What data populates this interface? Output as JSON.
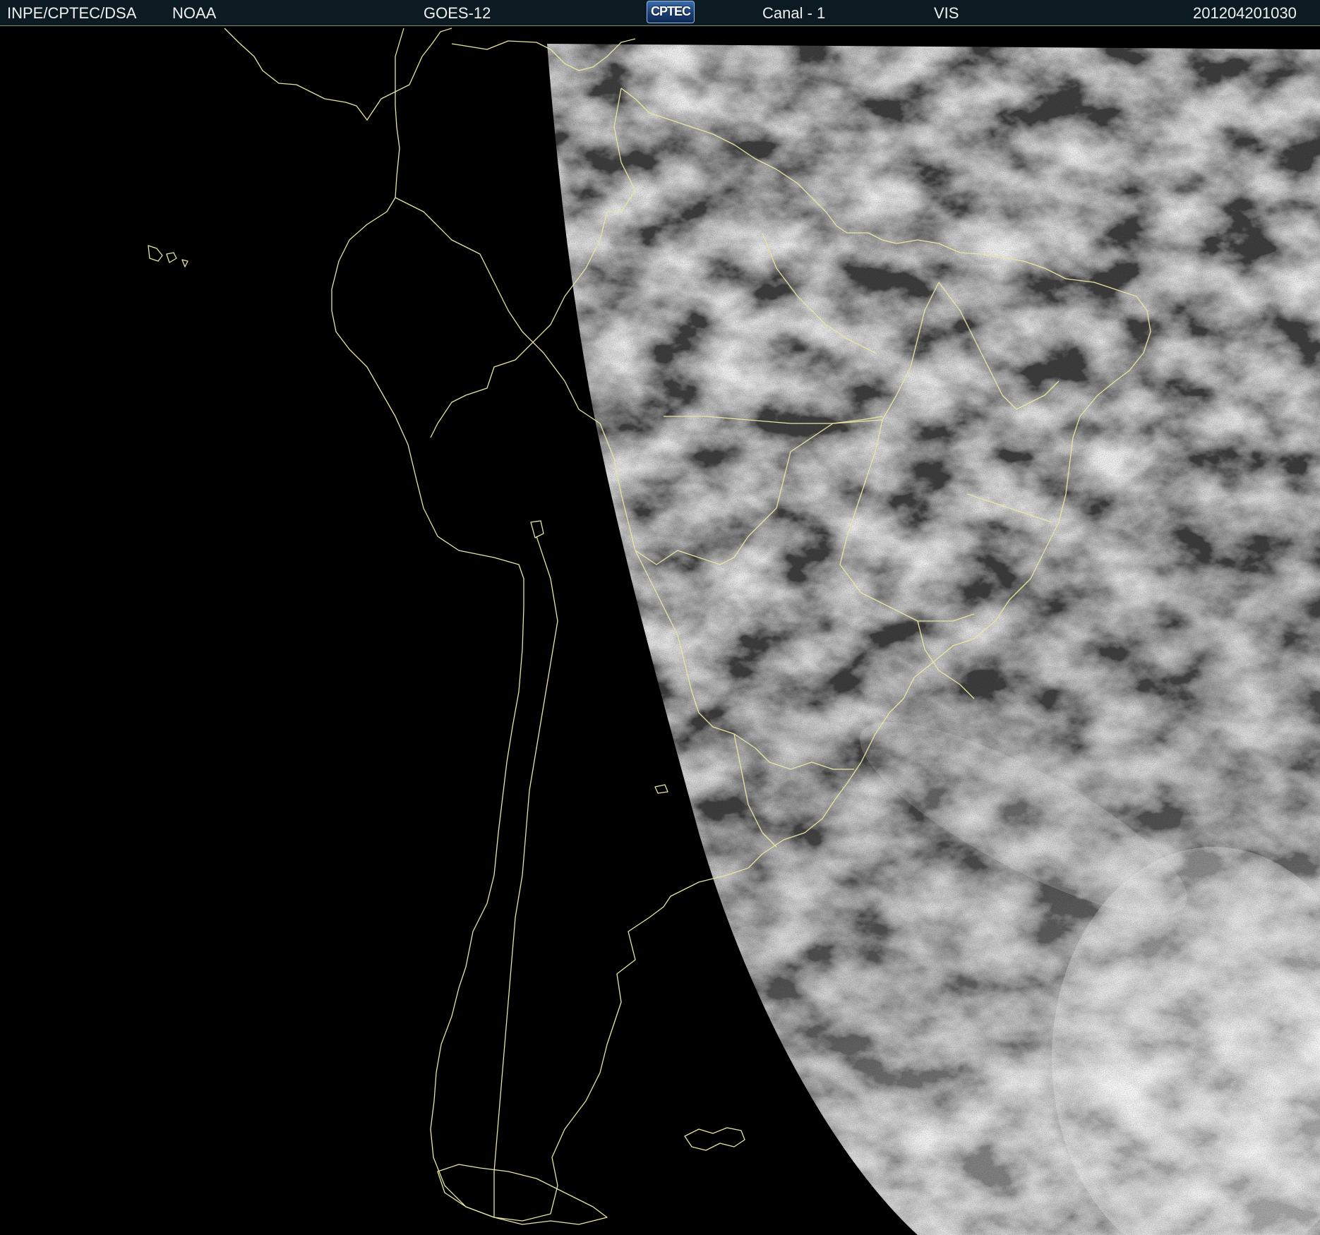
{
  "header": {
    "agency": "INPE/CPTEC/DSA",
    "source": "NOAA",
    "satellite": "GOES-12",
    "logo_text": "CPTEC",
    "channel": "Canal - 1",
    "band": "VIS",
    "timestamp": "201204201030"
  },
  "colors": {
    "background": "#000000",
    "header_bg": "#0c1a22",
    "header_text": "#f0f0f0",
    "coastline": "#e8e6a0",
    "cloud_dark": "#3a3a3a",
    "cloud_bright": "#e6e6e6"
  },
  "map": {
    "projection": "satellite visible channel, South America",
    "icons": [
      "cptec-logo-icon"
    ]
  }
}
